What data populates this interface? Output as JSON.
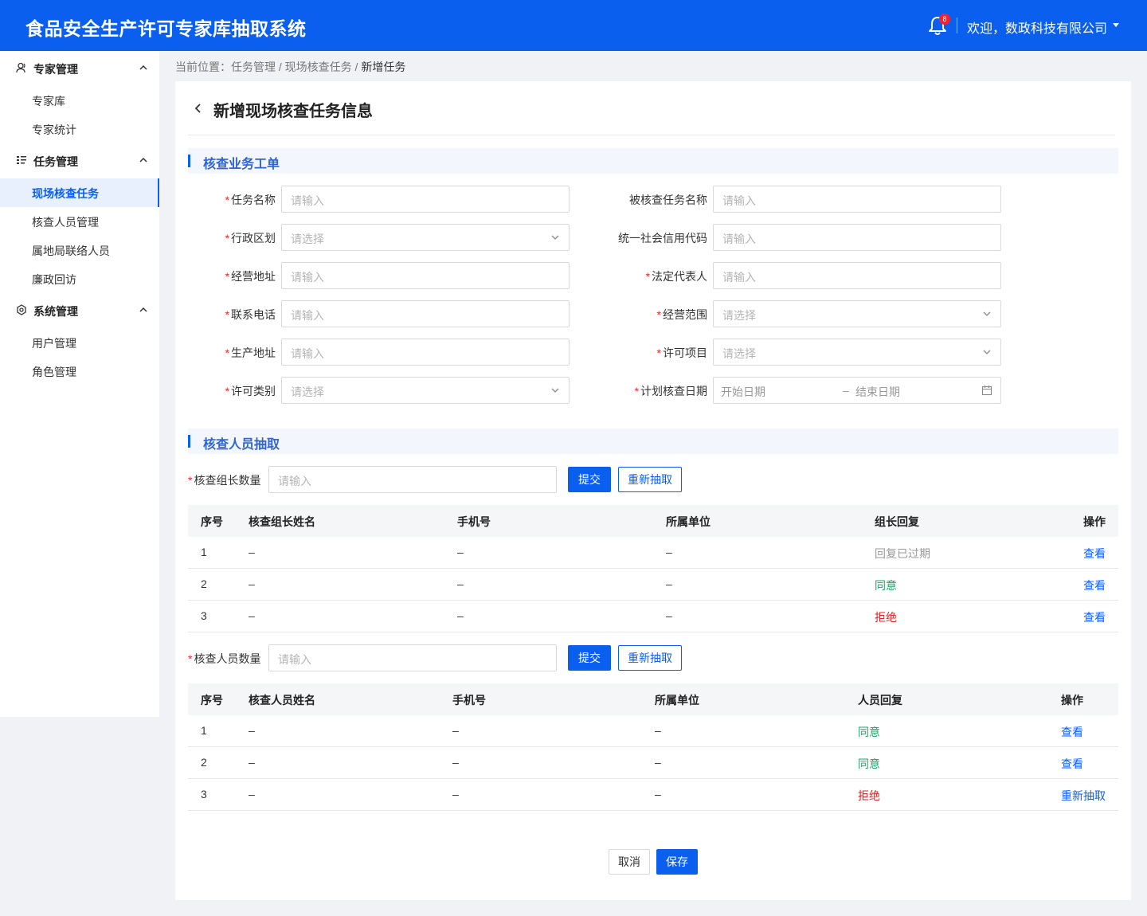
{
  "header": {
    "app_title": "食品安全生产许可专家库抽取系统",
    "notification_count": "8",
    "user_greeting": "欢迎，数政科技有限公司"
  },
  "sidebar": {
    "groups": [
      {
        "label": "专家管理",
        "icon": "user-icon",
        "items": [
          {
            "label": "专家库"
          },
          {
            "label": "专家统计"
          }
        ]
      },
      {
        "label": "任务管理",
        "icon": "list-icon",
        "items": [
          {
            "label": "现场核查任务",
            "active": true
          },
          {
            "label": "核查人员管理"
          },
          {
            "label": "属地局联络人员"
          },
          {
            "label": "廉政回访"
          }
        ]
      },
      {
        "label": "系统管理",
        "icon": "gear-icon",
        "items": [
          {
            "label": "用户管理"
          },
          {
            "label": "角色管理"
          }
        ]
      }
    ]
  },
  "breadcrumb": {
    "prefix": "当前位置：",
    "path": "任务管理 / 现场核查任务 / ",
    "current": "新增任务"
  },
  "page": {
    "title": "新增现场核查任务信息"
  },
  "form_section": {
    "title": "核查业务工单",
    "fields": {
      "task_name": {
        "label": "任务名称",
        "required": true,
        "placeholder": "请输入"
      },
      "inspected_name": {
        "label": "被核查任务名称",
        "required": false,
        "placeholder": "请输入"
      },
      "region": {
        "label": "行政区划",
        "required": true,
        "placeholder": "请选择"
      },
      "credit_code": {
        "label": "统一社会信用代码",
        "required": false,
        "placeholder": "请输入"
      },
      "biz_address": {
        "label": "经营地址",
        "required": true,
        "placeholder": "请输入"
      },
      "legal_rep": {
        "label": "法定代表人",
        "required": true,
        "placeholder": "请输入"
      },
      "phone": {
        "label": "联系电话",
        "required": true,
        "placeholder": "请输入"
      },
      "biz_scope": {
        "label": "经营范围",
        "required": true,
        "placeholder": "请选择"
      },
      "prod_address": {
        "label": "生产地址",
        "required": true,
        "placeholder": "请输入"
      },
      "license_item": {
        "label": "许可项目",
        "required": true,
        "placeholder": "请选择"
      },
      "license_type": {
        "label": "许可类别",
        "required": true,
        "placeholder": "请选择"
      },
      "plan_date": {
        "label": "计划核查日期",
        "required": true,
        "start_placeholder": "开始日期",
        "separator": "–",
        "end_placeholder": "结束日期"
      }
    }
  },
  "draw_section": {
    "title": "核查人员抽取",
    "leader": {
      "count_label": "核查组长数量",
      "placeholder": "请输入",
      "submit": "提交",
      "redraw": "重新抽取",
      "columns": [
        "序号",
        "核查组长姓名",
        "手机号",
        "所属单位",
        "组长回复",
        "操作"
      ],
      "rows": [
        {
          "no": "1",
          "name": "–",
          "phone": "–",
          "unit": "–",
          "reply": "回复已过期",
          "reply_status": "expired",
          "action": "查看"
        },
        {
          "no": "2",
          "name": "–",
          "phone": "–",
          "unit": "–",
          "reply": "同意",
          "reply_status": "agree",
          "action": "查看"
        },
        {
          "no": "3",
          "name": "–",
          "phone": "–",
          "unit": "–",
          "reply": "拒绝",
          "reply_status": "reject",
          "action": "查看"
        }
      ]
    },
    "member": {
      "count_label": "核查人员数量",
      "placeholder": "请输入",
      "submit": "提交",
      "redraw": "重新抽取",
      "columns": [
        "序号",
        "核查人员姓名",
        "手机号",
        "所属单位",
        "人员回复",
        "操作"
      ],
      "rows": [
        {
          "no": "1",
          "name": "–",
          "phone": "–",
          "unit": "–",
          "reply": "同意",
          "reply_status": "agree",
          "action": "查看"
        },
        {
          "no": "2",
          "name": "–",
          "phone": "–",
          "unit": "–",
          "reply": "同意",
          "reply_status": "agree",
          "action": "查看"
        },
        {
          "no": "3",
          "name": "–",
          "phone": "–",
          "unit": "–",
          "reply": "拒绝",
          "reply_status": "reject",
          "action": "重新抽取"
        }
      ]
    }
  },
  "footer": {
    "cancel": "取消",
    "save": "保存"
  },
  "colors": {
    "primary": "#0a5fef",
    "agree": "#19a463",
    "reject": "#e02020",
    "expired": "#999999"
  }
}
